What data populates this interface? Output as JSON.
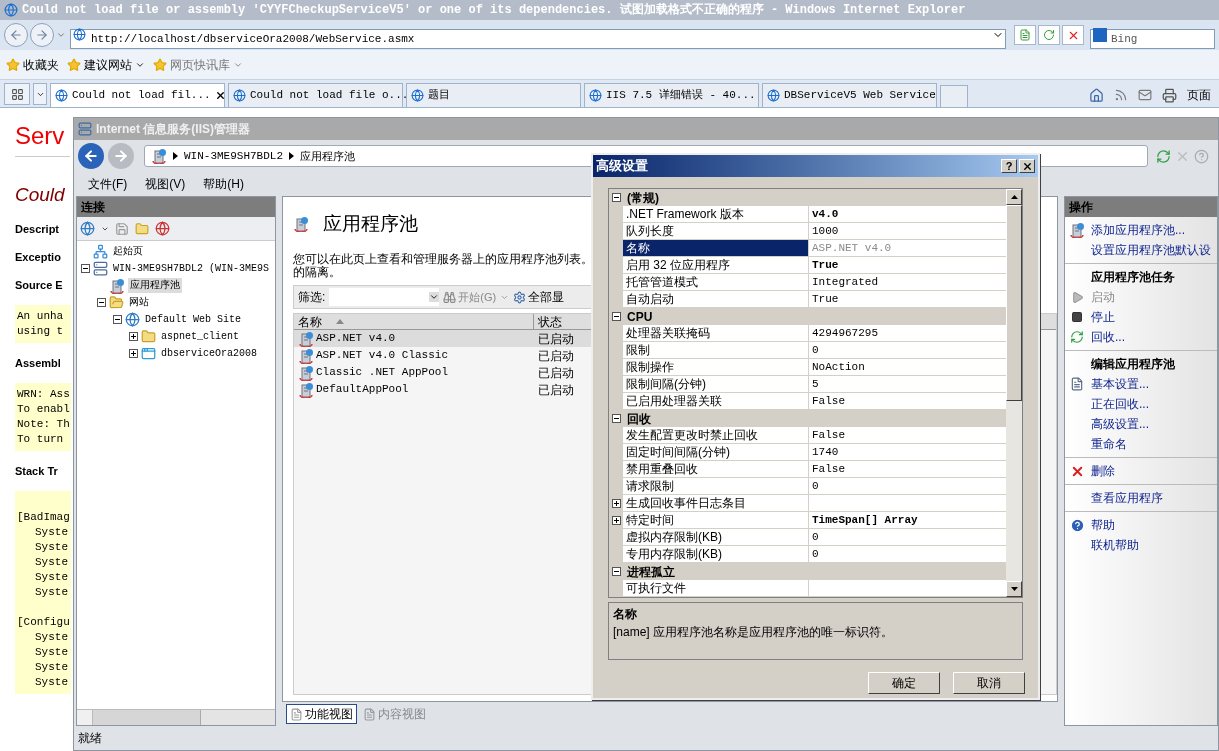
{
  "browser": {
    "title": "Could not load file or assembly 'CYYFCheckupServiceV5' or one of its dependencies. 试图加载格式不正确的程序 - Windows Internet Explorer",
    "address": "http://localhost/dbserviceOra2008/WebService.asmx",
    "search": {
      "placeholder": "Bing"
    },
    "favorites": [
      {
        "label": "收藏夹",
        "dropdown": false,
        "disabled": false
      },
      {
        "label": "建议网站",
        "dropdown": true,
        "disabled": false
      },
      {
        "label": "网页快讯库",
        "dropdown": true,
        "disabled": true
      }
    ],
    "tabs": [
      {
        "label": "Could not load fil...",
        "selected": true
      },
      {
        "label": "Could not load file o...",
        "selected": false
      },
      {
        "label": "题目",
        "selected": false
      },
      {
        "label": "IIS 7.5 详细错误 - 40...",
        "selected": false
      },
      {
        "label": "DBServiceV5 Web Service",
        "selected": false
      }
    ],
    "page_menu": "页面"
  },
  "page": {
    "heading": "Serv",
    "error_title": "Could",
    "sections": [
      {
        "kind": "label",
        "text": "Descript"
      },
      {
        "kind": "label",
        "text": "Exceptio"
      },
      {
        "kind": "label",
        "text": "Source E"
      },
      {
        "kind": "code",
        "groups": [
          {
            "lines": [
              "An unha",
              "using t"
            ]
          }
        ]
      },
      {
        "kind": "label",
        "text": "Assembl"
      },
      {
        "kind": "code",
        "groups": [
          {
            "lines": [
              "WRN: Ass",
              "To enabl",
              "Note: Th",
              "To turn"
            ]
          }
        ]
      },
      {
        "kind": "label",
        "text": "Stack Tr"
      },
      {
        "kind": "code",
        "groups": [
          {
            "heading": "[BadImag",
            "lines": [
              "Syste",
              "Syste",
              "Syste",
              "Syste",
              "Syste"
            ]
          },
          {
            "heading": "[Configu",
            "lines": [
              "Syste",
              "Syste",
              "Syste",
              "Syste"
            ]
          }
        ]
      }
    ]
  },
  "iis": {
    "title": "Internet 信息服务(IIS)管理器",
    "breadcrumb": [
      "WIN-3ME9SH7BDL2",
      "应用程序池"
    ],
    "menu": [
      "文件(F)",
      "视图(V)",
      "帮助(H)"
    ],
    "connections": {
      "title": "连接",
      "tree": [
        {
          "label": "起始页",
          "kind": "start",
          "selected": false
        },
        {
          "label": "WIN-3ME9SH7BDL2 (WIN-3ME9S",
          "kind": "server",
          "expanded": true,
          "selected": false,
          "children": [
            {
              "label": "应用程序池",
              "kind": "pools",
              "selected": true
            },
            {
              "label": "网站",
              "kind": "sites",
              "expanded": true,
              "selected": false,
              "children": [
                {
                  "label": "Default Web Site",
                  "kind": "site",
                  "expanded": true,
                  "selected": false,
                  "children": [
                    {
                      "label": "aspnet_client",
                      "kind": "folder",
                      "expanded": false,
                      "selected": false
                    },
                    {
                      "label": "dbserviceOra2008",
                      "kind": "app",
                      "expanded": false,
                      "selected": false
                    }
                  ]
                }
              ]
            }
          ]
        }
      ]
    },
    "center": {
      "title": "应用程序池",
      "description_lines": [
        "您可以在此页上查看和管理服务器上的应用程序池列表。",
        "的隔离。"
      ],
      "filter": {
        "label": "筛选:",
        "go": "开始(G)",
        "show_all": "全部显"
      },
      "columns": [
        {
          "label": "名称",
          "sorted": true
        },
        {
          "label": "状态",
          "sorted": false
        }
      ],
      "pools": [
        {
          "name": "ASP.NET v4.0",
          "status": "已启动",
          "selected": true
        },
        {
          "name": "ASP.NET v4.0 Classic",
          "status": "已启动",
          "selected": false
        },
        {
          "name": "Classic .NET AppPool",
          "status": "已启动",
          "selected": false
        },
        {
          "name": "DefaultAppPool",
          "status": "已启动",
          "selected": false
        }
      ],
      "views": [
        {
          "label": "功能视图",
          "selected": true
        },
        {
          "label": "内容视图",
          "selected": false
        }
      ]
    },
    "actions": {
      "title": "操作",
      "groups": [
        {
          "items": [
            {
              "label": "添加应用程序池...",
              "kind": "action",
              "disabled": false
            },
            {
              "label": "设置应用程序池默认设",
              "kind": "action",
              "disabled": false
            }
          ]
        },
        {
          "items": [
            {
              "label": "应用程序池任务",
              "kind": "heading"
            },
            {
              "label": "启动",
              "kind": "action",
              "disabled": true
            },
            {
              "label": "停止",
              "kind": "action",
              "disabled": false
            },
            {
              "label": "回收...",
              "kind": "action",
              "disabled": false
            }
          ]
        },
        {
          "items": [
            {
              "label": "编辑应用程序池",
              "kind": "heading"
            },
            {
              "label": "基本设置...",
              "kind": "action",
              "disabled": false
            },
            {
              "label": "正在回收...",
              "kind": "action",
              "disabled": false
            },
            {
              "label": "高级设置...",
              "kind": "action",
              "disabled": false
            },
            {
              "label": "重命名",
              "kind": "action",
              "disabled": false
            }
          ]
        },
        {
          "items": [
            {
              "label": "删除",
              "kind": "action",
              "disabled": false
            }
          ]
        },
        {
          "items": [
            {
              "label": "查看应用程序",
              "kind": "action",
              "disabled": false
            }
          ]
        },
        {
          "items": [
            {
              "label": "帮助",
              "kind": "action",
              "disabled": false
            },
            {
              "label": "联机帮助",
              "kind": "action",
              "disabled": false
            }
          ]
        }
      ]
    },
    "status": "就绪"
  },
  "dialog": {
    "title": "高级设置",
    "help": "?",
    "categories": [
      {
        "name": "(常规)",
        "expanded": true,
        "rows": [
          {
            "name": ".NET Framework 版本",
            "value": "v4.0",
            "kind": "field",
            "modified": true,
            "readonly": false,
            "selected": false
          },
          {
            "name": "队列长度",
            "value": "1000",
            "kind": "field",
            "modified": false,
            "readonly": false,
            "selected": false
          },
          {
            "name": "名称",
            "value": "ASP.NET v4.0",
            "kind": "field",
            "modified": false,
            "readonly": true,
            "selected": true
          },
          {
            "name": "启用 32 位应用程序",
            "value": "True",
            "kind": "field",
            "modified": true,
            "readonly": false,
            "selected": false
          },
          {
            "name": "托管管道模式",
            "value": "Integrated",
            "kind": "field",
            "modified": false,
            "readonly": false,
            "selected": false
          },
          {
            "name": "自动启动",
            "value": "True",
            "kind": "field",
            "modified": false,
            "readonly": false,
            "selected": false
          }
        ]
      },
      {
        "name": "CPU",
        "expanded": true,
        "rows": [
          {
            "name": "处理器关联掩码",
            "value": "4294967295",
            "kind": "field",
            "modified": false,
            "readonly": false,
            "selected": false
          },
          {
            "name": "限制",
            "value": "0",
            "kind": "field",
            "modified": false,
            "readonly": false,
            "selected": false
          },
          {
            "name": "限制操作",
            "value": "NoAction",
            "kind": "field",
            "modified": false,
            "readonly": false,
            "selected": false
          },
          {
            "name": "限制间隔(分钟)",
            "value": "5",
            "kind": "field",
            "modified": false,
            "readonly": false,
            "selected": false
          },
          {
            "name": "已启用处理器关联",
            "value": "False",
            "kind": "field",
            "modified": false,
            "readonly": false,
            "selected": false
          }
        ]
      },
      {
        "name": "回收",
        "expanded": true,
        "rows": [
          {
            "name": "发生配置更改时禁止回收",
            "value": "False",
            "kind": "field",
            "modified": false,
            "readonly": false,
            "selected": false
          },
          {
            "name": "固定时间间隔(分钟)",
            "value": "1740",
            "kind": "field",
            "modified": false,
            "readonly": false,
            "selected": false
          },
          {
            "name": "禁用重叠回收",
            "value": "False",
            "kind": "field",
            "modified": false,
            "readonly": false,
            "selected": false
          },
          {
            "name": "请求限制",
            "value": "0",
            "kind": "field",
            "modified": false,
            "readonly": false,
            "selected": false
          },
          {
            "name": "生成回收事件日志条目",
            "kind": "group",
            "expanded": false,
            "modified": false,
            "selected": false
          },
          {
            "name": "特定时间",
            "value": "TimeSpan[] Array",
            "kind": "group",
            "expanded": false,
            "modified": true,
            "readonly": false,
            "selected": false
          },
          {
            "name": "虚拟内存限制(KB)",
            "value": "0",
            "kind": "field",
            "modified": false,
            "readonly": false,
            "selected": false
          },
          {
            "name": "专用内存限制(KB)",
            "value": "0",
            "kind": "field",
            "modified": false,
            "readonly": false,
            "selected": false
          }
        ]
      },
      {
        "name": "进程孤立",
        "expanded": true,
        "rows": [
          {
            "name": "可执行文件",
            "kind": "field",
            "modified": false,
            "selected": false
          }
        ]
      }
    ],
    "description": {
      "title": "名称",
      "text": "[name] 应用程序池名称是应用程序池的唯一标识符。"
    },
    "buttons": [
      "确定",
      "取消"
    ]
  }
}
